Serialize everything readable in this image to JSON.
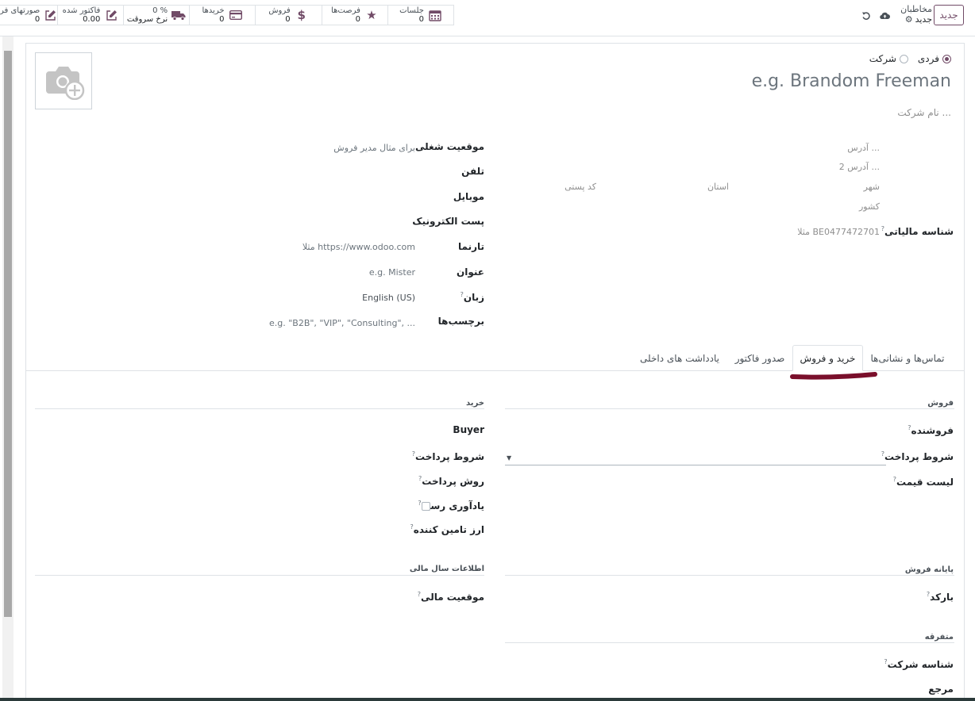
{
  "topbar": {
    "new_label": "جدید",
    "breadcrumb_parent": "مخاطبان",
    "breadcrumb_current": "جدید",
    "stats": [
      {
        "label": "جلسات",
        "value": "0",
        "icon": "calendar-icon"
      },
      {
        "label": "فرصت‌ها",
        "value": "0",
        "icon": "star-icon"
      },
      {
        "label": "فروش",
        "value": "0",
        "icon": "dollar-icon"
      },
      {
        "label": "خریدها",
        "value": "0",
        "icon": "credit-card-icon"
      },
      {
        "label": "0 %",
        "value": "نرخ سروقت",
        "icon": "truck-icon"
      },
      {
        "label": "فاکتور شده",
        "value": "0.00",
        "icon": "pencil-square-icon"
      },
      {
        "label": "صورتهای فر",
        "value": "0",
        "icon": "pencil-square-icon"
      }
    ]
  },
  "header": {
    "radio_individual": "فردی",
    "radio_company": "شرکت",
    "name_placeholder": "e.g. Brandom Freeman",
    "company_placeholder": "نام شرکت ..."
  },
  "address": {
    "street": "آدرس ...",
    "street2": "آدرس 2 ...",
    "city": "شهر",
    "state": "استان",
    "zip": "کد پستی",
    "country": "کشور",
    "vat_label": "شناسه مالیاتی",
    "vat_placeholder": "مثلا  BE0477472701"
  },
  "contact": {
    "job_label": "موقعیت شغلی",
    "job_placeholder": "برای مثال مدیر فروش",
    "phone_label": "تلفن",
    "mobile_label": "موبایل",
    "email_label": "پست الکترونیک",
    "website_label": "تارنما",
    "website_placeholder": "مثلا  https://www.odoo.com",
    "title_label": "عنوان",
    "title_placeholder": "e.g. Mister",
    "lang_label": "زبان",
    "lang_value": "English (US)",
    "tags_label": "برچسب‌ها",
    "tags_placeholder": "e.g. \"B2B\", \"VIP\", \"Consulting\", ..."
  },
  "tabs": [
    {
      "label": "تماس‌ها و نشانی‌ها"
    },
    {
      "label": "خرید و فروش"
    },
    {
      "label": "صدور فاکتور"
    },
    {
      "label": "یادداشت های داخلی"
    }
  ],
  "sales": {
    "title": "فروش",
    "salesperson": "فروشنده",
    "payment_terms": "شروط پرداخت",
    "pricelist": "لیست قیمت"
  },
  "purchase": {
    "title": "خرید",
    "buyer": "Buyer",
    "payment_terms": "شروط پرداخت",
    "payment_method": "روش پرداخت",
    "receipt_reminder": "یادآوری رسید",
    "supplier_currency": "ارز تامین کننده"
  },
  "pos": {
    "title": "پایانه فروش",
    "barcode": "بارکد"
  },
  "fiscal": {
    "title": "اطلاعات سال مالی",
    "position": "موقعیت مالی"
  },
  "misc": {
    "title": "متفرقه",
    "company_id": "شناسه شرکت",
    "reference": "مرجع"
  },
  "colors": {
    "brand": "#714b67",
    "annotation": "#7a0f2b"
  }
}
